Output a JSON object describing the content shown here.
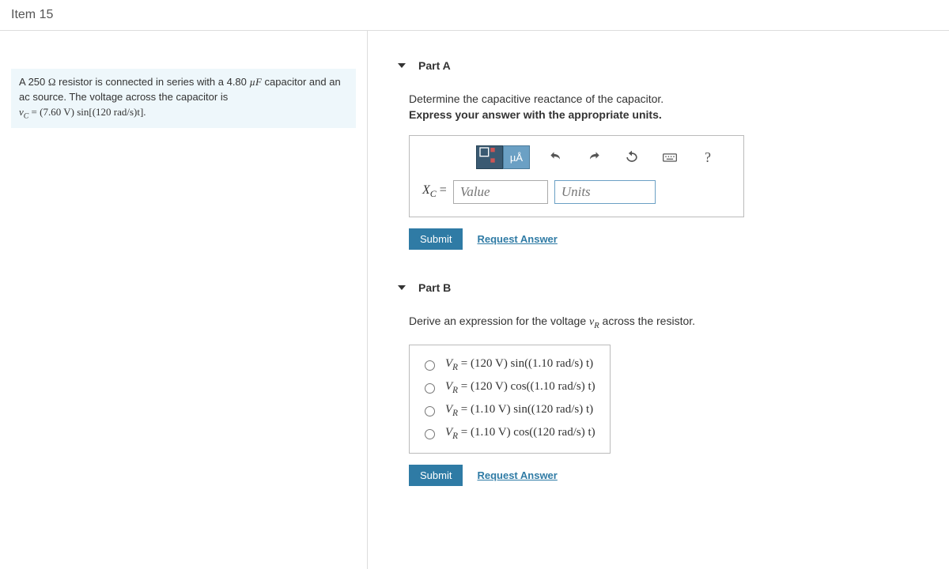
{
  "header": {
    "title": "Item 15"
  },
  "problem": {
    "line1_pre": "A 250 ",
    "line1_unit": "Ω",
    "line1_mid": " resistor is connected in series with a 4.80 ",
    "line1_cap_val": "µF",
    "line1_post": " capacitor and an ac source. The voltage across the capacitor is",
    "eq_lhs": "v",
    "eq_sub": "C",
    "eq_rhs": " = (7.60 V) sin[(120 rad/s)t]."
  },
  "partA": {
    "label": "Part A",
    "prompt": "Determine the capacitive reactance of the capacitor.",
    "instruction": "Express your answer with the appropriate units.",
    "var": "X",
    "var_sub": "C",
    "equals": " = ",
    "value_placeholder": "Value",
    "units_placeholder": "Units",
    "submit": "Submit",
    "request": "Request Answer",
    "help": "?",
    "mu_label": "µÅ"
  },
  "partB": {
    "label": "Part B",
    "prompt_pre": "Derive an expression for the voltage ",
    "prompt_var": "v",
    "prompt_sub": "R",
    "prompt_post": " across the resistor.",
    "options": [
      {
        "lhs": "V",
        "sub": "R",
        "rhs": " = (120 V) sin((1.10 rad/s) t)"
      },
      {
        "lhs": "V",
        "sub": "R",
        "rhs": " = (120 V) cos((1.10 rad/s) t)"
      },
      {
        "lhs": "V",
        "sub": "R",
        "rhs": " = (1.10 V) sin((120 rad/s) t)"
      },
      {
        "lhs": "V",
        "sub": "R",
        "rhs": " = (1.10 V) cos((120 rad/s) t)"
      }
    ],
    "submit": "Submit",
    "request": "Request Answer"
  }
}
